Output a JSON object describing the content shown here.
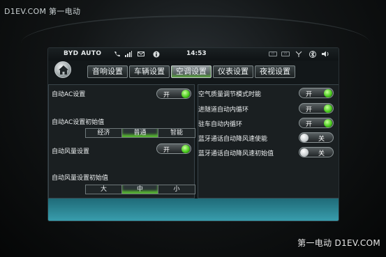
{
  "watermarks": {
    "top_left": "D1EV.COM 第一电动",
    "bottom_right": "第一电动 D1EV.COM"
  },
  "status_bar": {
    "brand": "BYD AUTO",
    "time": "14:53",
    "icons": [
      "phone-icon",
      "signal-icon",
      "mail-icon",
      "info-icon",
      "usb-icon",
      "sd-card-icon",
      "antenna-icon",
      "bluetooth-icon",
      "volume-icon"
    ]
  },
  "tabs": [
    {
      "label": "音响设置",
      "active": false
    },
    {
      "label": "车辆设置",
      "active": false
    },
    {
      "label": "空调设置",
      "active": true
    },
    {
      "label": "仪表设置",
      "active": false
    },
    {
      "label": "夜视设置",
      "active": false
    }
  ],
  "left": {
    "auto_ac_label": "自动AC设置",
    "auto_ac_toggle": "开",
    "auto_ac_init_label": "自动AC设置初始值",
    "auto_ac_init_options": [
      "经济",
      "普通",
      "智能"
    ],
    "auto_ac_init_selected": "普通",
    "auto_fan_label": "自动风量设置",
    "auto_fan_toggle": "开",
    "auto_fan_init_label": "自动风量设置初始值",
    "auto_fan_init_options": [
      "大",
      "中",
      "小"
    ],
    "auto_fan_init_selected": "中"
  },
  "right": {
    "rows": [
      {
        "label": "空气质量调节模式时能",
        "value": "开",
        "on": true
      },
      {
        "label": "进隧道自动内循环",
        "value": "开",
        "on": true
      },
      {
        "label": "驻车自动内循环",
        "value": "开",
        "on": true
      },
      {
        "label": "蓝牙通话自动降风速使能",
        "value": "关",
        "on": false
      },
      {
        "label": "蓝牙通话自动降风速初始值",
        "value": "关",
        "on": false
      }
    ]
  },
  "colors": {
    "accent_green": "#4bcc1f",
    "footer_teal": "#2a8a9a"
  }
}
